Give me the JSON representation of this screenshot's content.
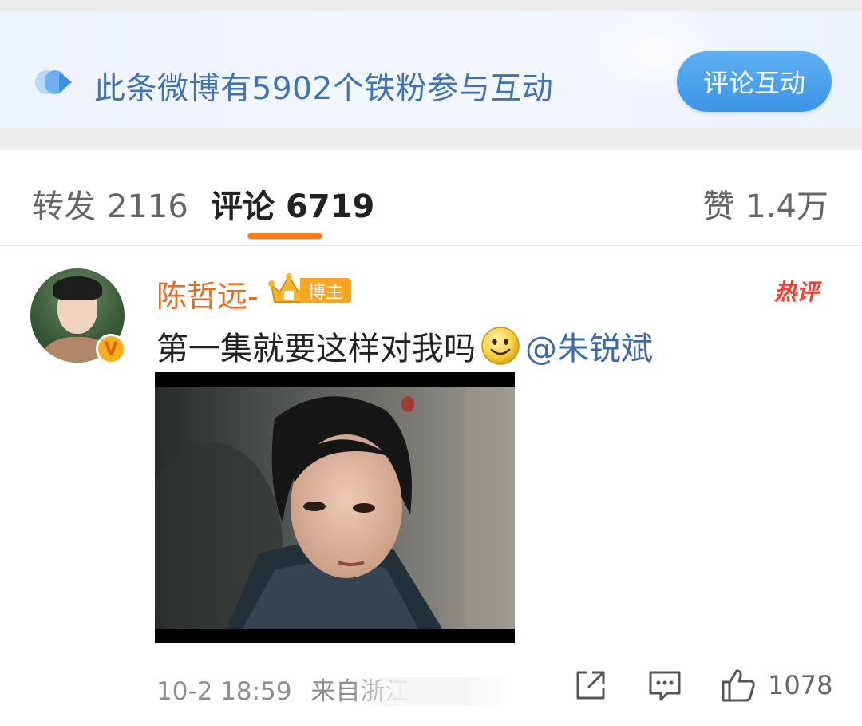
{
  "banner": {
    "text": "此条微博有5902个铁粉参与互动",
    "button_label": "评论互动"
  },
  "tabs": {
    "repost": {
      "label": "转发",
      "count": "2116"
    },
    "comment": {
      "label": "评论",
      "count": "6719"
    },
    "like": {
      "label": "赞",
      "count": "1.4万"
    }
  },
  "comment": {
    "username": "陈哲远-",
    "badge_label": "博主",
    "verified_label": "V",
    "hot_label": "热评",
    "text": "第一集就要这样对我吗",
    "mention": "@朱锐斌",
    "date": "10-2 18:59",
    "location": "来自浙江",
    "like_count": "1078"
  },
  "colors": {
    "accent_orange": "#ff7a1a",
    "username": "#e86b1f",
    "banner_text": "#3f73b6",
    "button": "#3c94e6",
    "hot": "#e8443a",
    "mention": "#3f6aa6"
  },
  "icons": {
    "banner": "interaction-icon",
    "verified": "verified-v-icon",
    "crown": "crown-icon",
    "smiley": "smiley-emoji",
    "share": "share-icon",
    "comment": "comment-icon",
    "like": "thumbs-up-icon"
  }
}
